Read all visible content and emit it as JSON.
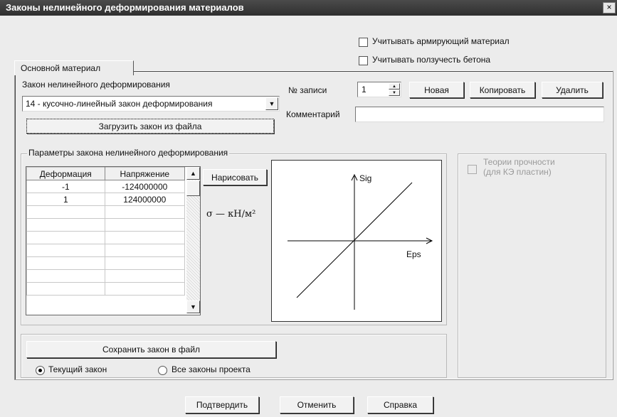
{
  "window": {
    "title": "Законы нелинейного деформирования материалов",
    "close_label": "×"
  },
  "options": {
    "reinforcement": "Учитывать армирующий материал",
    "creep": "Учитывать ползучесть бетона"
  },
  "tab": {
    "label": "Основной материал"
  },
  "law": {
    "section_label": "Закон нелинейного деформирования",
    "selected": "14 - кусочно-линейный закон деформирования",
    "load_button": "Загрузить закон из файла"
  },
  "record": {
    "label": "№ записи",
    "value": "1",
    "new_button": "Новая",
    "copy_button": "Копировать",
    "delete_button": "Удалить",
    "comment_label": "Комментарий",
    "comment_value": ""
  },
  "params": {
    "title": "Параметры закона нелинейного деформирования",
    "columns": [
      "Деформация",
      "Напряжение"
    ],
    "rows": [
      [
        "-1",
        "-124000000"
      ],
      [
        "1",
        "124000000"
      ],
      [
        "",
        ""
      ],
      [
        "",
        ""
      ],
      [
        "",
        ""
      ],
      [
        "",
        ""
      ],
      [
        "",
        ""
      ],
      [
        "",
        ""
      ],
      [
        "",
        ""
      ]
    ],
    "draw_button": "Нарисовать",
    "units": "σ — кН/м²",
    "axis_y": "Sig",
    "axis_x": "Eps"
  },
  "strength": {
    "label_line1": "Теории прочности",
    "label_line2": "(для КЭ пластин)"
  },
  "save": {
    "button": "Сохранить закон в файл",
    "current": "Текущий закон",
    "all": "Все законы проекта"
  },
  "footer": {
    "confirm": "Подтвердить",
    "cancel": "Отменить",
    "help": "Справка"
  }
}
